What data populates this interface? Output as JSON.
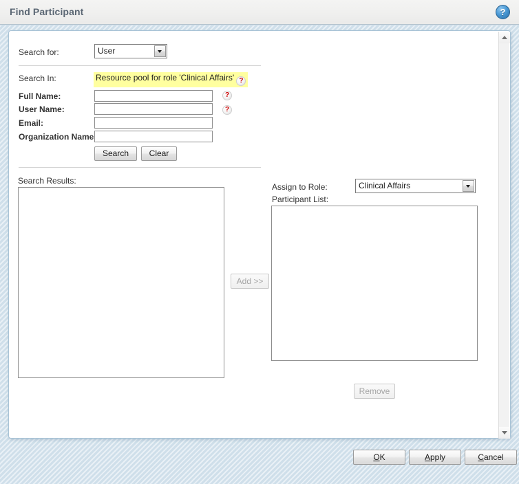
{
  "window": {
    "title": "Find Participant",
    "help_icon": "help-circle-icon",
    "help_glyph": "?"
  },
  "form": {
    "search_for_label": "Search for:",
    "search_for_value": "User",
    "search_in_label": "Search In:",
    "search_in_value": "Resource pool for role 'Clinical Affairs'",
    "fields": [
      {
        "label": "Full Name:",
        "value": "",
        "has_help": true
      },
      {
        "label": "User Name:",
        "value": "",
        "has_help": true
      },
      {
        "label": "Email:",
        "value": "",
        "has_help": false
      },
      {
        "label": "Organization Name:",
        "value": "",
        "has_help": false
      }
    ],
    "search_button": "Search",
    "clear_button": "Clear"
  },
  "results": {
    "label": "Search Results:",
    "items": []
  },
  "transfer": {
    "add_button": "Add >>",
    "remove_button": "Remove"
  },
  "assign": {
    "role_label": "Assign to Role:",
    "role_value": "Clinical Affairs",
    "participant_label": "Participant List:",
    "participants": []
  },
  "footer": {
    "ok": "OK",
    "ok_accel": "O",
    "ok_rest": "K",
    "apply": "Apply",
    "apply_accel": "A",
    "apply_rest": "pply",
    "cancel": "Cancel",
    "cancel_accel": "C",
    "cancel_rest": "ancel"
  },
  "colors": {
    "title_text": "#5a6673",
    "backdrop": "#cfdfea",
    "highlight": "#ffff9f",
    "help_red": "#cc0000",
    "help_blue": "#4a9ad6"
  },
  "scrollbar": {
    "up_icon": "scroll-up-arrow-icon",
    "down_icon": "scroll-down-arrow-icon"
  }
}
